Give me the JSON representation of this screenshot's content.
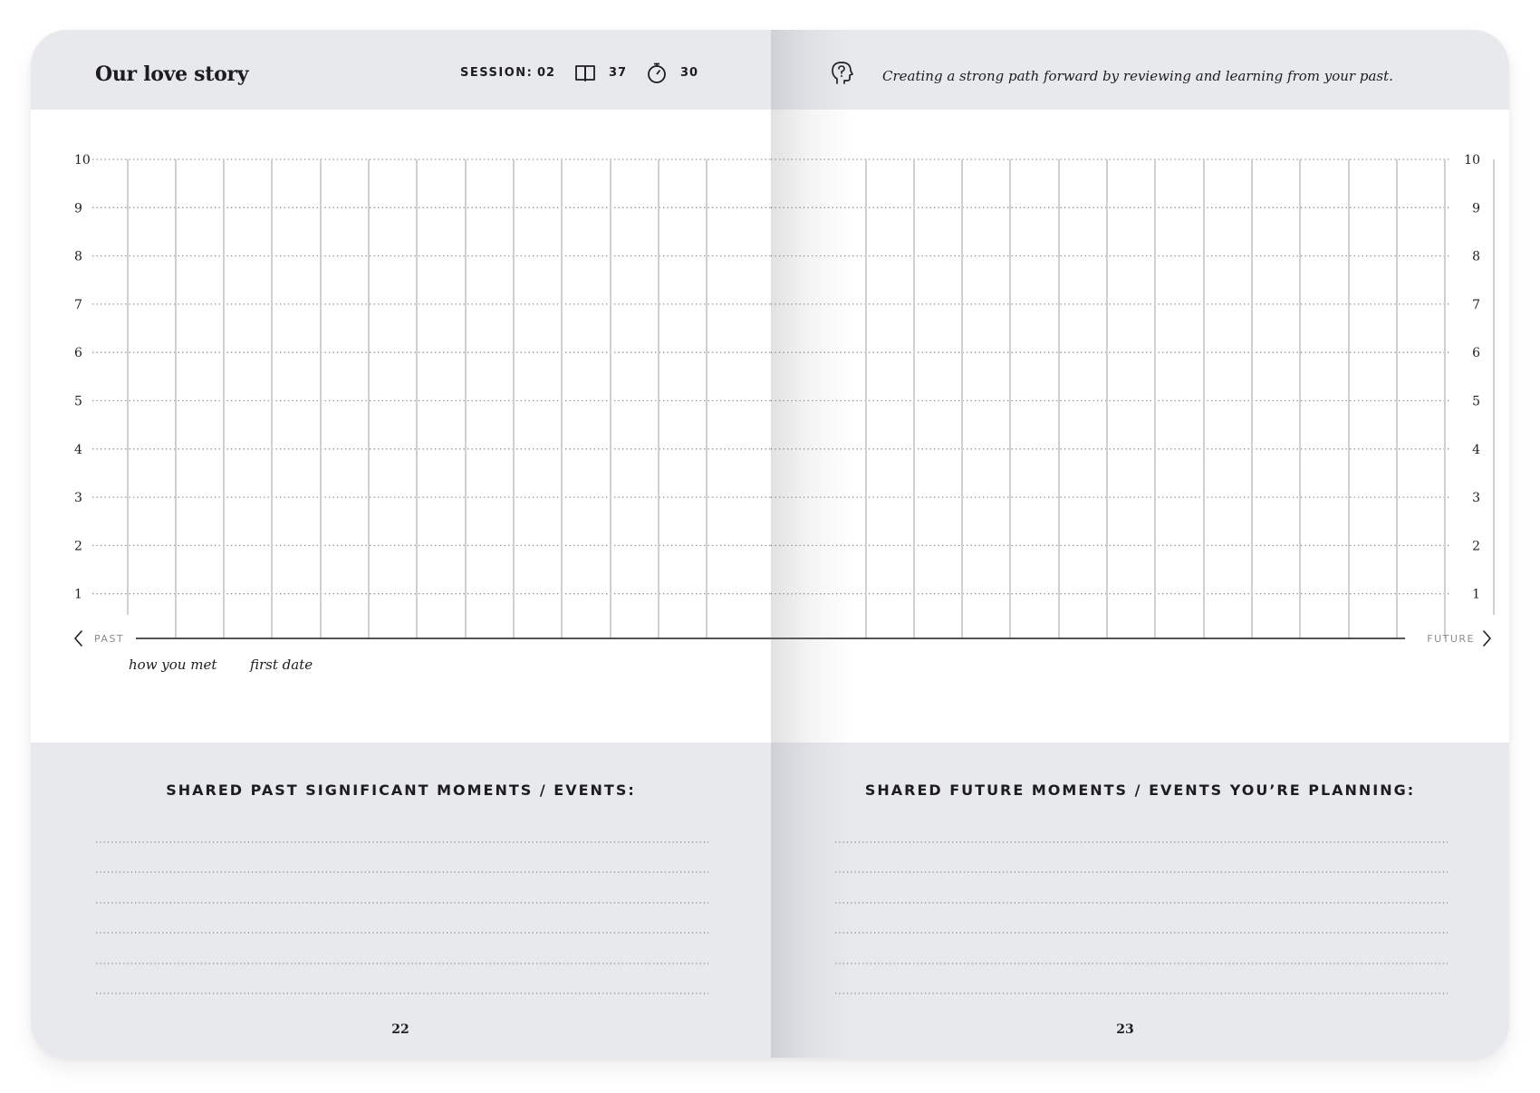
{
  "left_page": {
    "title": "Our love story",
    "session_label": "SESSION:",
    "session_value": "02",
    "pages_value": "37",
    "minutes_value": "30",
    "past_label": "PAST",
    "annotations": [
      "how you met",
      "first date"
    ],
    "section_heading": "SHARED PAST SIGNIFICANT MOMENTS / EVENTS:",
    "page_number": "22"
  },
  "right_page": {
    "subtitle": "Creating a strong path forward by reviewing and learning from your past.",
    "future_label": "FUTURE",
    "section_heading": "SHARED FUTURE MOMENTS / EVENTS YOU’RE PLANNING:",
    "page_number": "23"
  },
  "scale": {
    "left_axis": [
      "10",
      "9",
      "8",
      "7",
      "6",
      "5",
      "4",
      "3",
      "2",
      "1"
    ],
    "right_axis": [
      "10",
      "9",
      "8",
      "7",
      "6",
      "5",
      "4",
      "3",
      "2",
      "1"
    ]
  },
  "colors": {
    "band": "#e7e9ed",
    "grid_line": "#cfd0d3",
    "dotted_line": "#8a8c90",
    "ink": "#1d1d1f"
  },
  "icons": [
    "book-icon",
    "timer-icon",
    "head-question-icon",
    "chevron-left-icon",
    "chevron-right-icon"
  ]
}
